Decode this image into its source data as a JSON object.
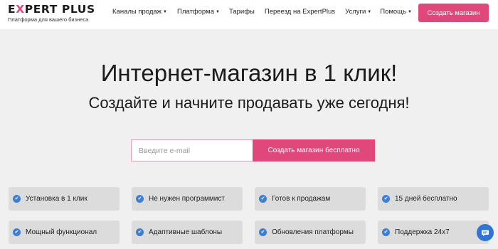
{
  "header": {
    "logo": {
      "prefix": "E",
      "x": "X",
      "rest": "PERT PLUS",
      "subtitle": "Платформа для вашего бизнеса"
    },
    "nav": [
      {
        "label": "Каналы продаж",
        "dropdown": true
      },
      {
        "label": "Платформа",
        "dropdown": true
      },
      {
        "label": "Тарифы",
        "dropdown": false
      },
      {
        "label": "Переезд на ExpertPlus",
        "dropdown": false
      },
      {
        "label": "Услуги",
        "dropdown": true
      },
      {
        "label": "Помощь",
        "dropdown": true
      }
    ],
    "cta_label": "Создать магазин"
  },
  "hero": {
    "title": "Интернет-магазин в 1 клик!",
    "subtitle": "Создайте и начните продавать уже сегодня!"
  },
  "signup": {
    "email_placeholder": "Введите e-mail",
    "button_label": "Создать магазин бесплатно"
  },
  "features": [
    "Установка в 1 клик",
    "Не нужен программист",
    "Готов к продажам",
    "15 дней бесплатно",
    "Мощный функционал",
    "Адаптивные шаблоны",
    "Обновления платформы",
    "Поддержка 24x7"
  ],
  "icons": {
    "check": "check-circle-icon",
    "chat": "chat-icon"
  },
  "colors": {
    "accent": "#e0477b",
    "check": "#3d7fd6",
    "chat": "#3273d6",
    "background": "#f0f0f0",
    "feature_bg": "#dcdcdc"
  }
}
